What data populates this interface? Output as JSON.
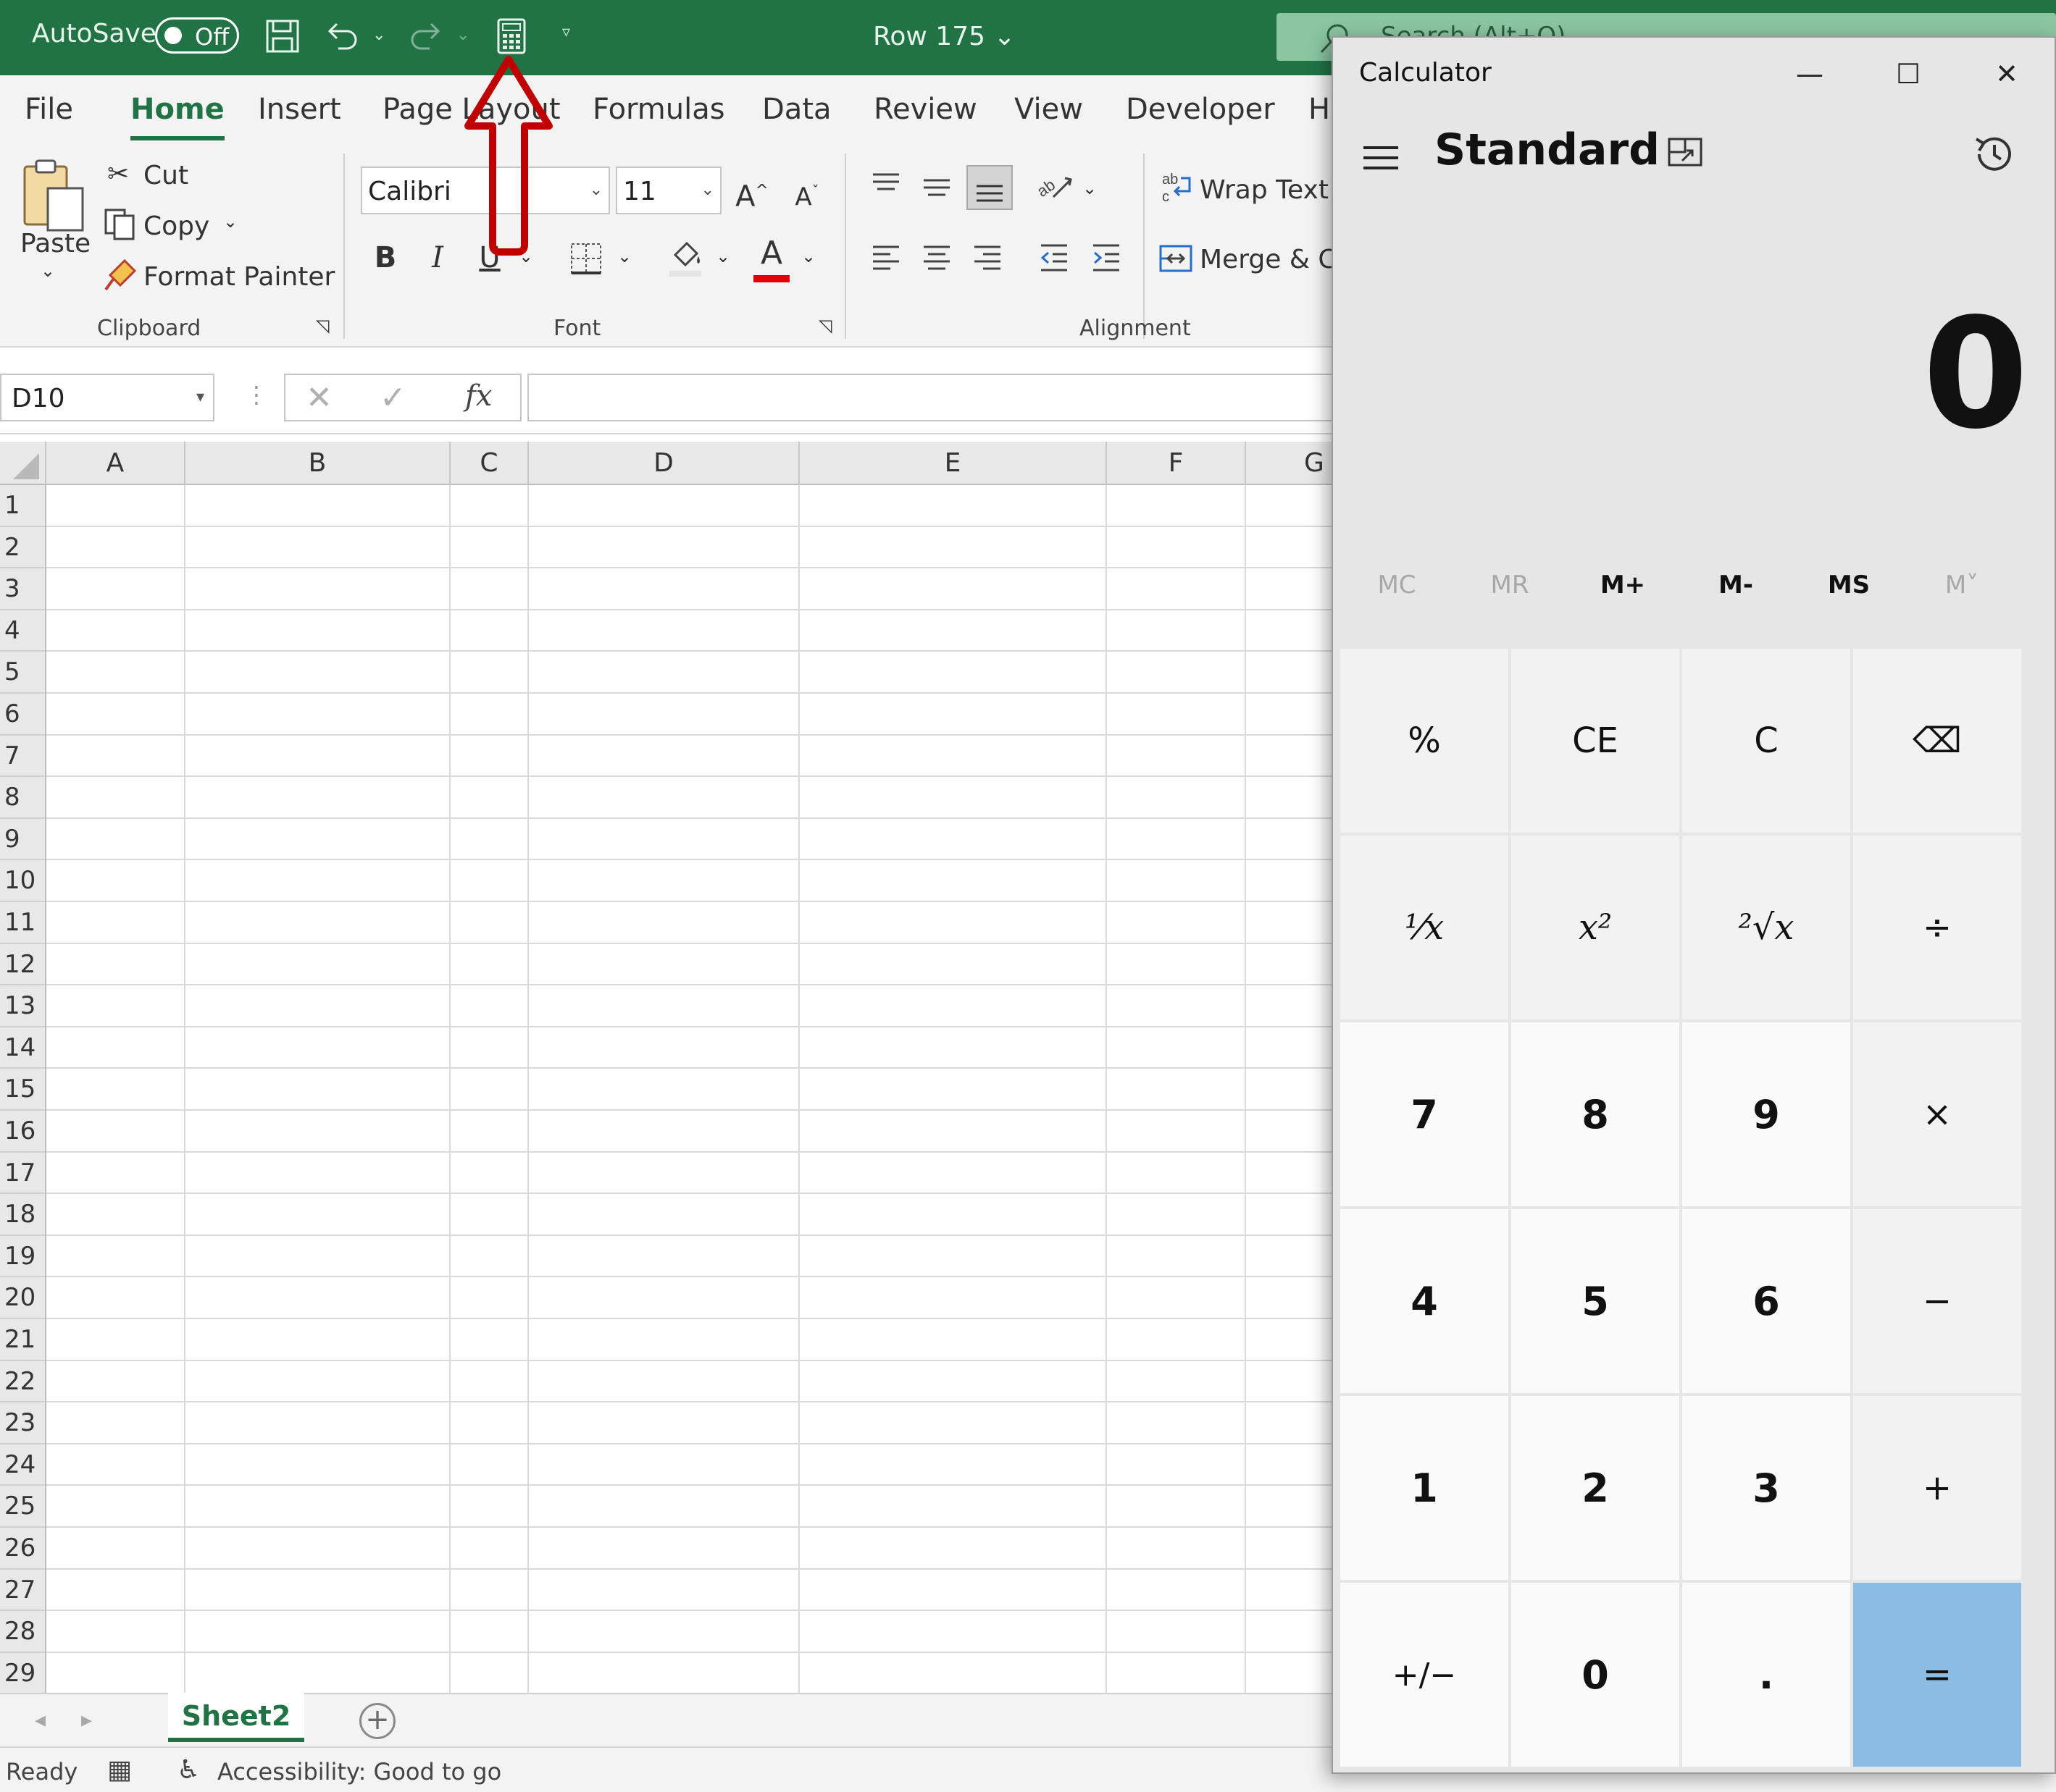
{
  "titlebar": {
    "autosave_label": "AutoSave",
    "autosave_state": "Off",
    "doc_title": "Row 175",
    "search_placeholder": "Search (Alt+Q)"
  },
  "ribbon_tabs": [
    "File",
    "Home",
    "Insert",
    "Page Layout",
    "Formulas",
    "Data",
    "Review",
    "View",
    "Developer",
    "H"
  ],
  "active_tab": "Home",
  "clipboard": {
    "paste": "Paste",
    "cut": "Cut",
    "copy": "Copy",
    "format_painter": "Format Painter",
    "group_label": "Clipboard"
  },
  "font": {
    "family": "Calibri",
    "size": "11",
    "bold": "B",
    "italic": "I",
    "underline": "U",
    "group_label": "Font",
    "grow": "A",
    "shrink": "A",
    "font_color_letter": "A"
  },
  "alignment": {
    "wrap_text": "Wrap Text",
    "merge": "Merge & Ce",
    "group_label": "Alignment"
  },
  "formula_bar": {
    "name_box": "D10",
    "fx": "fx",
    "value": ""
  },
  "grid": {
    "columns": [
      "A",
      "B",
      "C",
      "D",
      "E",
      "F",
      "G"
    ],
    "rows": [
      "1",
      "2",
      "3",
      "4",
      "5",
      "6",
      "7",
      "8",
      "9",
      "10",
      "11",
      "12",
      "13",
      "14",
      "15",
      "16",
      "17",
      "18",
      "19",
      "20",
      "21",
      "22",
      "23",
      "24",
      "25",
      "26",
      "27",
      "28",
      "29"
    ]
  },
  "sheets": {
    "active": "Sheet2",
    "add": "+"
  },
  "status": {
    "ready": "Ready",
    "accessibility": "Accessibility: Good to go"
  },
  "calculator": {
    "title": "Calculator",
    "mode": "Standard",
    "display": "0",
    "window": {
      "minimize": "—",
      "maximize": "☐",
      "close": "✕"
    },
    "memory": [
      {
        "label": "MC",
        "enabled": false
      },
      {
        "label": "MR",
        "enabled": false
      },
      {
        "label": "M+",
        "enabled": true
      },
      {
        "label": "M-",
        "enabled": true
      },
      {
        "label": "MS",
        "enabled": true
      },
      {
        "label": "M˅",
        "enabled": false
      }
    ],
    "keys": [
      [
        "%",
        "CE",
        "C",
        "⌫"
      ],
      [
        "¹⁄x",
        "x²",
        "²√x",
        "÷"
      ],
      [
        "7",
        "8",
        "9",
        "×"
      ],
      [
        "4",
        "5",
        "6",
        "−"
      ],
      [
        "1",
        "2",
        "3",
        "+"
      ],
      [
        "+/−",
        "0",
        ".",
        "="
      ]
    ],
    "accent_color": "#8bbde4"
  },
  "colors": {
    "excel_green": "#217346",
    "annotation_red": "#c00000"
  }
}
